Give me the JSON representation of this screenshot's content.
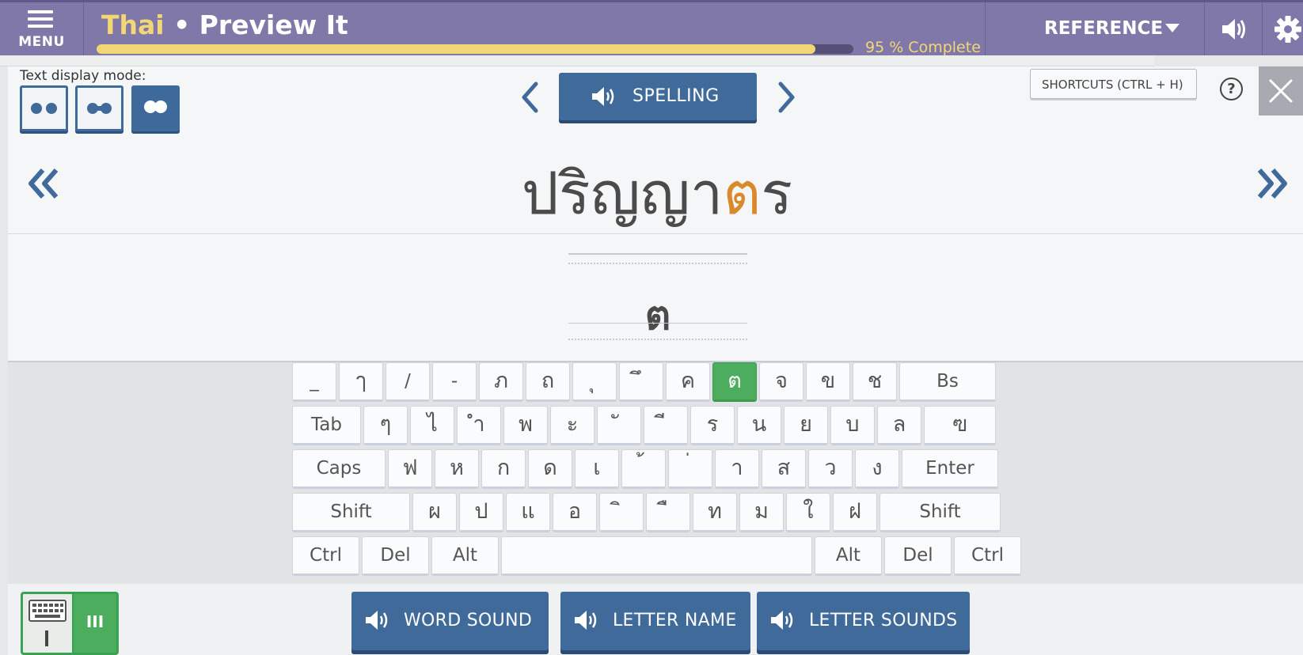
{
  "header": {
    "menu_label": "MENU",
    "title_language": "Thai",
    "title_separator": " • ",
    "title_activity": "Preview It",
    "progress_percent": 95,
    "progress_text": "95 % Complete",
    "reference_label": "REFERENCE"
  },
  "toolbar": {
    "text_display_mode_label": "Text display mode:",
    "spelling_label": "SPELLING",
    "shortcuts_label": "SHORTCUTS (CTRL + H)",
    "help_label": "?"
  },
  "word": {
    "prefix": "ปริญญา",
    "highlight": "ต",
    "suffix": "ร"
  },
  "answer": {
    "typed": "ต"
  },
  "keyboard": {
    "rows": [
      [
        {
          "label": "_",
          "w": 56
        },
        {
          "label": "ๅ",
          "w": 56,
          "thai": true
        },
        {
          "label": "/",
          "w": 56
        },
        {
          "label": "-",
          "w": 56
        },
        {
          "label": "ภ",
          "w": 56,
          "thai": true
        },
        {
          "label": "ถ",
          "w": 56,
          "thai": true
        },
        {
          "label": "ุ",
          "w": 56,
          "thai": true
        },
        {
          "label": "ึ",
          "w": 56,
          "thai": true
        },
        {
          "label": "ค",
          "w": 56,
          "thai": true
        },
        {
          "label": "ต",
          "w": 56,
          "thai": true,
          "on": true
        },
        {
          "label": "จ",
          "w": 56,
          "thai": true
        },
        {
          "label": "ข",
          "w": 56,
          "thai": true
        },
        {
          "label": "ช",
          "w": 56,
          "thai": true
        },
        {
          "label": "Bs",
          "w": 122
        }
      ],
      [
        {
          "label": "Tab",
          "w": 87
        },
        {
          "label": "ๆ",
          "w": 56,
          "thai": true
        },
        {
          "label": "ไ",
          "w": 56,
          "thai": true
        },
        {
          "label": "ำ",
          "w": 56,
          "thai": true
        },
        {
          "label": "พ",
          "w": 56,
          "thai": true
        },
        {
          "label": "ะ",
          "w": 56,
          "thai": true
        },
        {
          "label": "ั",
          "w": 56,
          "thai": true
        },
        {
          "label": "ี",
          "w": 56,
          "thai": true
        },
        {
          "label": "ร",
          "w": 56,
          "thai": true
        },
        {
          "label": "น",
          "w": 56,
          "thai": true
        },
        {
          "label": "ย",
          "w": 56,
          "thai": true
        },
        {
          "label": "บ",
          "w": 56,
          "thai": true
        },
        {
          "label": "ล",
          "w": 56,
          "thai": true
        },
        {
          "label": "ฃ",
          "w": 91,
          "thai": true
        }
      ],
      [
        {
          "label": "Caps",
          "w": 118
        },
        {
          "label": "ฟ",
          "w": 56,
          "thai": true
        },
        {
          "label": "ห",
          "w": 56,
          "thai": true
        },
        {
          "label": "ก",
          "w": 56,
          "thai": true
        },
        {
          "label": "ด",
          "w": 56,
          "thai": true
        },
        {
          "label": "เ",
          "w": 56,
          "thai": true
        },
        {
          "label": "้",
          "w": 56,
          "thai": true
        },
        {
          "label": "่",
          "w": 56,
          "thai": true
        },
        {
          "label": "า",
          "w": 56,
          "thai": true
        },
        {
          "label": "ส",
          "w": 56,
          "thai": true
        },
        {
          "label": "ว",
          "w": 56,
          "thai": true
        },
        {
          "label": "ง",
          "w": 56,
          "thai": true
        },
        {
          "label": "Enter",
          "w": 122
        }
      ],
      [
        {
          "label": "Shift",
          "w": 149
        },
        {
          "label": "ผ",
          "w": 56,
          "thai": true
        },
        {
          "label": "ป",
          "w": 56,
          "thai": true
        },
        {
          "label": "แ",
          "w": 56,
          "thai": true
        },
        {
          "label": "อ",
          "w": 56,
          "thai": true
        },
        {
          "label": "ิ",
          "w": 56,
          "thai": true
        },
        {
          "label": "ื",
          "w": 56,
          "thai": true
        },
        {
          "label": "ท",
          "w": 56,
          "thai": true
        },
        {
          "label": "ม",
          "w": 56,
          "thai": true
        },
        {
          "label": "ใ",
          "w": 56,
          "thai": true
        },
        {
          "label": "ฝ",
          "w": 56,
          "thai": true
        },
        {
          "label": "Shift",
          "w": 153
        }
      ],
      [
        {
          "label": "Ctrl",
          "w": 85
        },
        {
          "label": "Del",
          "w": 85
        },
        {
          "label": "Alt",
          "w": 85
        },
        {
          "label": "",
          "w": 393
        },
        {
          "label": "Alt",
          "w": 85
        },
        {
          "label": "Del",
          "w": 85
        },
        {
          "label": "Ctrl",
          "w": 85
        }
      ]
    ]
  },
  "sound_buttons": {
    "word_sound": "WORD SOUND",
    "letter_name": "LETTER NAME",
    "letter_sounds": "LETTER SOUNDS"
  },
  "colors": {
    "header_bg": "#7f78a9",
    "accent_blue": "#3f6a9a",
    "progress_yellow": "#f4d775",
    "highlight_orange": "#d98a2c",
    "active_key_green": "#4cad5e"
  }
}
